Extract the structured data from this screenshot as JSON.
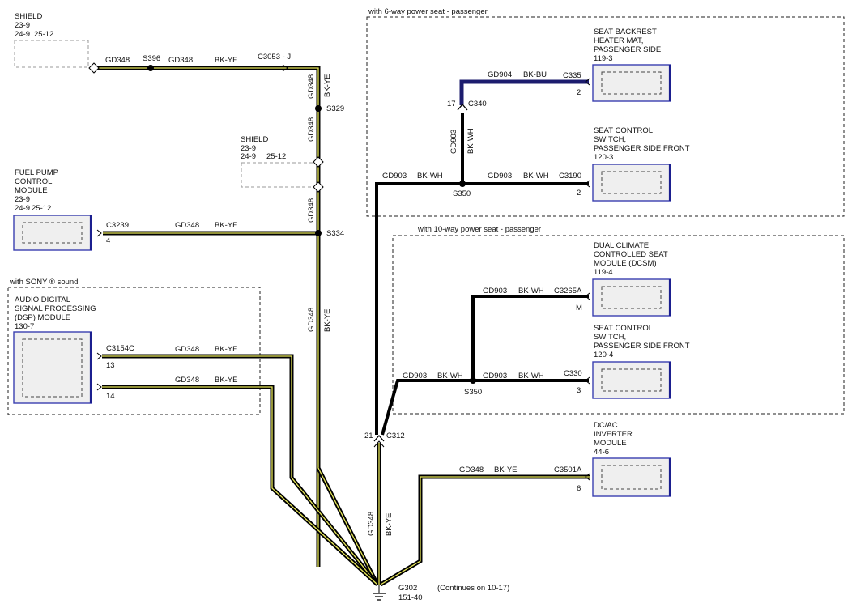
{
  "top_shield": {
    "title": "SHIELD",
    "ref1": "23-9",
    "ref2": "24-9",
    "ref3": "25-12"
  },
  "mid_shield": {
    "title": "SHIELD",
    "ref1": "23-9",
    "ref2": "24-9",
    "ref3": "25-12"
  },
  "fuel_pump": {
    "name1": "FUEL PUMP",
    "name2": "CONTROL",
    "name3": "MODULE",
    "ref1": "23-9",
    "ref2": "24-9",
    "ref3": "25-12",
    "connector": "C3239",
    "pin": "4"
  },
  "dsp": {
    "box_title": "with SONY ® sound",
    "name1": "AUDIO DIGITAL",
    "name2": "SIGNAL PROCESSING",
    "name3": "(DSP) MODULE",
    "ref": "130-7",
    "connector": "C3154C",
    "pin1": "13",
    "pin2": "14"
  },
  "circuits": {
    "gd348": "GD348",
    "bkye": "BK-YE",
    "gd903": "GD903",
    "bkwh": "BK-WH",
    "gd904": "GD904",
    "bkbu": "BK-BU"
  },
  "splices": {
    "s396": "S396",
    "s329": "S329",
    "s334": "S334",
    "s350a": "S350",
    "s350b": "S350"
  },
  "inline": {
    "c3053": "C3053 - J",
    "c340": "C340",
    "c340_pin": "17",
    "c312": "C312",
    "c312_pin": "21"
  },
  "box6": {
    "title": "with 6-way power seat - passenger"
  },
  "box10": {
    "title": "with 10-way power seat - passenger"
  },
  "heater_mat": {
    "name1": "SEAT BACKREST",
    "name2": "HEATER MAT,",
    "name3": "PASSENGER SIDE",
    "ref": "119-3",
    "connector": "C335",
    "pin": "2"
  },
  "switch6": {
    "name1": "SEAT CONTROL",
    "name2": "SWITCH,",
    "name3": "PASSENGER SIDE FRONT",
    "ref": "120-3",
    "connector": "C3190",
    "pin": "2"
  },
  "dcsm": {
    "name1": "DUAL CLIMATE",
    "name2": "CONTROLLED SEAT",
    "name3": "MODULE (DCSM)",
    "ref": "119-4",
    "connector": "C3265A",
    "pin": "M"
  },
  "switch10": {
    "name1": "SEAT CONTROL",
    "name2": "SWITCH,",
    "name3": "PASSENGER SIDE FRONT",
    "ref": "120-4",
    "connector": "C330",
    "pin": "3"
  },
  "inverter": {
    "name1": "DC/AC",
    "name2": "INVERTER",
    "name3": "MODULE",
    "ref": "44-6",
    "connector": "C3501A",
    "pin": "6"
  },
  "ground": {
    "name": "G302",
    "ref": "151-40",
    "note": "(Continues on 10-17)"
  }
}
